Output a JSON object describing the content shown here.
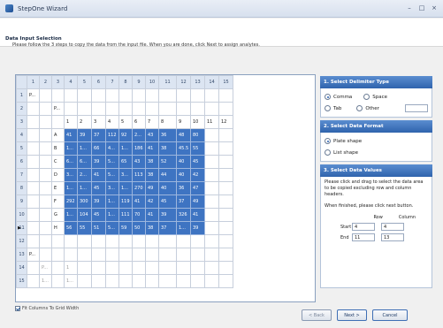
{
  "window": {
    "title": "StepOne Wizard",
    "controls": [
      "–",
      "□",
      "×"
    ]
  },
  "header": {
    "title": "Data Input Selection",
    "subtitle": "Please follow the 3 steps to copy the data from the input file. When you are done, click Next to assign analytes."
  },
  "grid": {
    "columns": [
      "1",
      "2",
      "3",
      "4",
      "5",
      "6",
      "7",
      "8",
      "9",
      "10",
      "11",
      "12",
      "13",
      "14",
      "15"
    ],
    "rows": [
      {
        "num": "1",
        "cells": [
          "P...",
          "",
          "",
          "",
          "",
          "",
          "",
          "",
          "",
          "",
          "",
          "",
          "",
          "",
          ""
        ]
      },
      {
        "num": "2",
        "cells": [
          "",
          "",
          "P...",
          "",
          "",
          "",
          "",
          "",
          "",
          "",
          "",
          "",
          "",
          "",
          ""
        ]
      },
      {
        "num": "3",
        "cells": [
          "",
          "",
          "",
          "1",
          "2",
          "3",
          "4",
          "5",
          "6",
          "7",
          "8",
          "9",
          "10",
          "11",
          "12"
        ]
      },
      {
        "num": "4",
        "cells": [
          "",
          "",
          "A",
          "41",
          "39",
          "37",
          "112",
          "92",
          "2...",
          "43",
          "36",
          "48",
          "80",
          "",
          ""
        ]
      },
      {
        "num": "5",
        "cells": [
          "",
          "",
          "B",
          "1...",
          "1...",
          "66",
          "4...",
          "1...",
          "186",
          "41",
          "38",
          "45.5",
          "55",
          "",
          ""
        ]
      },
      {
        "num": "6",
        "cells": [
          "",
          "",
          "C",
          "6...",
          "6...",
          "39",
          "5...",
          "65",
          "43",
          "38",
          "52",
          "40",
          "45",
          "",
          ""
        ]
      },
      {
        "num": "7",
        "cells": [
          "",
          "",
          "D",
          "3...",
          "2...",
          "41",
          "5...",
          "3...",
          "113",
          "38",
          "44",
          "40",
          "42",
          "",
          ""
        ]
      },
      {
        "num": "8",
        "cells": [
          "",
          "",
          "E",
          "1...",
          "1...",
          "45",
          "3...",
          "1...",
          "270",
          "49",
          "40",
          "36",
          "47",
          "",
          ""
        ]
      },
      {
        "num": "9",
        "cells": [
          "",
          "",
          "F",
          "292",
          "300",
          "39",
          "1...",
          "119",
          "41",
          "42",
          "45",
          "37",
          "49",
          "",
          ""
        ]
      },
      {
        "num": "10",
        "cells": [
          "",
          "",
          "G",
          "1...",
          "104",
          "45",
          "1...",
          "111",
          "70",
          "41",
          "39",
          "326",
          "41",
          "",
          ""
        ]
      },
      {
        "num": "11",
        "cells": [
          "",
          "",
          "H",
          "56",
          "55",
          "51",
          "5...",
          "59",
          "50",
          "38",
          "37",
          "1...",
          "39",
          "",
          ""
        ]
      },
      {
        "num": "12",
        "cells": [
          "",
          "",
          "",
          "",
          "",
          "",
          "",
          "",
          "",
          "",
          "",
          "",
          "",
          "",
          ""
        ]
      },
      {
        "num": "13",
        "cells": [
          "P...",
          "",
          "",
          "",
          "",
          "",
          "",
          "",
          "",
          "",
          "",
          "",
          "",
          "",
          ""
        ]
      },
      {
        "num": "14",
        "cells": [
          "",
          "P...",
          "",
          "1",
          "",
          "",
          "",
          "",
          "",
          "",
          "",
          "",
          "",
          "",
          ""
        ]
      },
      {
        "num": "15",
        "cells": [
          "",
          "1...",
          "",
          "1...",
          "",
          "",
          "",
          "",
          "",
          "",
          "",
          "",
          "",
          "",
          ""
        ]
      }
    ],
    "current_row": "11"
  },
  "fit_columns": {
    "label": "Fit Columns To Grid Width",
    "checked": true
  },
  "panel": {
    "delimiter": {
      "title": "1. Select Delimiter Type",
      "options": [
        "Comma",
        "Space",
        "Tab",
        "Other"
      ],
      "selected": "Comma"
    },
    "format": {
      "title": "2. Select Data Format",
      "options": [
        "Plate shape",
        "List shape"
      ],
      "selected": "Plate shape"
    },
    "values": {
      "title": "3. Select Data Values",
      "instructions": "Please click and drag to select the data area to be copied excluding row and column headers.",
      "finish_note": "When finished, please click next button.",
      "row_label": "Row",
      "column_label": "Column",
      "start_label": "Start",
      "end_label": "End",
      "start_row": "4",
      "start_col": "4",
      "end_row": "11",
      "end_col": "13"
    }
  },
  "footer": {
    "back": "< Back",
    "next": "Next >",
    "cancel": "Cancel"
  }
}
